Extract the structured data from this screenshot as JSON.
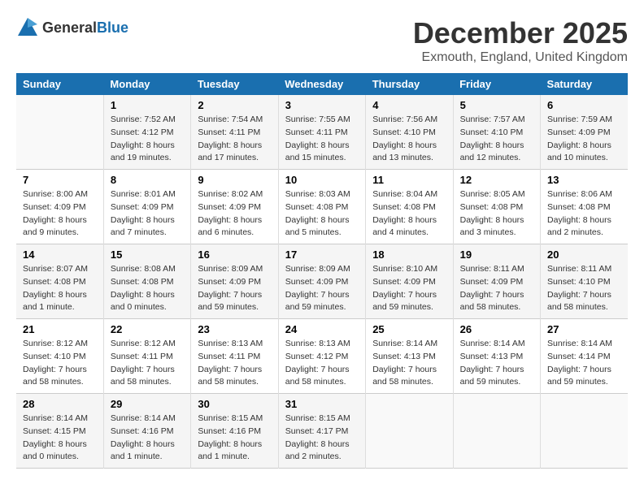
{
  "header": {
    "logo_general": "General",
    "logo_blue": "Blue",
    "month_title": "December 2025",
    "location": "Exmouth, England, United Kingdom"
  },
  "days_of_week": [
    "Sunday",
    "Monday",
    "Tuesday",
    "Wednesday",
    "Thursday",
    "Friday",
    "Saturday"
  ],
  "weeks": [
    [
      {
        "day": "",
        "info": ""
      },
      {
        "day": "1",
        "info": "Sunrise: 7:52 AM\nSunset: 4:12 PM\nDaylight: 8 hours\nand 19 minutes."
      },
      {
        "day": "2",
        "info": "Sunrise: 7:54 AM\nSunset: 4:11 PM\nDaylight: 8 hours\nand 17 minutes."
      },
      {
        "day": "3",
        "info": "Sunrise: 7:55 AM\nSunset: 4:11 PM\nDaylight: 8 hours\nand 15 minutes."
      },
      {
        "day": "4",
        "info": "Sunrise: 7:56 AM\nSunset: 4:10 PM\nDaylight: 8 hours\nand 13 minutes."
      },
      {
        "day": "5",
        "info": "Sunrise: 7:57 AM\nSunset: 4:10 PM\nDaylight: 8 hours\nand 12 minutes."
      },
      {
        "day": "6",
        "info": "Sunrise: 7:59 AM\nSunset: 4:09 PM\nDaylight: 8 hours\nand 10 minutes."
      }
    ],
    [
      {
        "day": "7",
        "info": "Sunrise: 8:00 AM\nSunset: 4:09 PM\nDaylight: 8 hours\nand 9 minutes."
      },
      {
        "day": "8",
        "info": "Sunrise: 8:01 AM\nSunset: 4:09 PM\nDaylight: 8 hours\nand 7 minutes."
      },
      {
        "day": "9",
        "info": "Sunrise: 8:02 AM\nSunset: 4:09 PM\nDaylight: 8 hours\nand 6 minutes."
      },
      {
        "day": "10",
        "info": "Sunrise: 8:03 AM\nSunset: 4:08 PM\nDaylight: 8 hours\nand 5 minutes."
      },
      {
        "day": "11",
        "info": "Sunrise: 8:04 AM\nSunset: 4:08 PM\nDaylight: 8 hours\nand 4 minutes."
      },
      {
        "day": "12",
        "info": "Sunrise: 8:05 AM\nSunset: 4:08 PM\nDaylight: 8 hours\nand 3 minutes."
      },
      {
        "day": "13",
        "info": "Sunrise: 8:06 AM\nSunset: 4:08 PM\nDaylight: 8 hours\nand 2 minutes."
      }
    ],
    [
      {
        "day": "14",
        "info": "Sunrise: 8:07 AM\nSunset: 4:08 PM\nDaylight: 8 hours\nand 1 minute."
      },
      {
        "day": "15",
        "info": "Sunrise: 8:08 AM\nSunset: 4:08 PM\nDaylight: 8 hours\nand 0 minutes."
      },
      {
        "day": "16",
        "info": "Sunrise: 8:09 AM\nSunset: 4:09 PM\nDaylight: 7 hours\nand 59 minutes."
      },
      {
        "day": "17",
        "info": "Sunrise: 8:09 AM\nSunset: 4:09 PM\nDaylight: 7 hours\nand 59 minutes."
      },
      {
        "day": "18",
        "info": "Sunrise: 8:10 AM\nSunset: 4:09 PM\nDaylight: 7 hours\nand 59 minutes."
      },
      {
        "day": "19",
        "info": "Sunrise: 8:11 AM\nSunset: 4:09 PM\nDaylight: 7 hours\nand 58 minutes."
      },
      {
        "day": "20",
        "info": "Sunrise: 8:11 AM\nSunset: 4:10 PM\nDaylight: 7 hours\nand 58 minutes."
      }
    ],
    [
      {
        "day": "21",
        "info": "Sunrise: 8:12 AM\nSunset: 4:10 PM\nDaylight: 7 hours\nand 58 minutes."
      },
      {
        "day": "22",
        "info": "Sunrise: 8:12 AM\nSunset: 4:11 PM\nDaylight: 7 hours\nand 58 minutes."
      },
      {
        "day": "23",
        "info": "Sunrise: 8:13 AM\nSunset: 4:11 PM\nDaylight: 7 hours\nand 58 minutes."
      },
      {
        "day": "24",
        "info": "Sunrise: 8:13 AM\nSunset: 4:12 PM\nDaylight: 7 hours\nand 58 minutes."
      },
      {
        "day": "25",
        "info": "Sunrise: 8:14 AM\nSunset: 4:13 PM\nDaylight: 7 hours\nand 58 minutes."
      },
      {
        "day": "26",
        "info": "Sunrise: 8:14 AM\nSunset: 4:13 PM\nDaylight: 7 hours\nand 59 minutes."
      },
      {
        "day": "27",
        "info": "Sunrise: 8:14 AM\nSunset: 4:14 PM\nDaylight: 7 hours\nand 59 minutes."
      }
    ],
    [
      {
        "day": "28",
        "info": "Sunrise: 8:14 AM\nSunset: 4:15 PM\nDaylight: 8 hours\nand 0 minutes."
      },
      {
        "day": "29",
        "info": "Sunrise: 8:14 AM\nSunset: 4:16 PM\nDaylight: 8 hours\nand 1 minute."
      },
      {
        "day": "30",
        "info": "Sunrise: 8:15 AM\nSunset: 4:16 PM\nDaylight: 8 hours\nand 1 minute."
      },
      {
        "day": "31",
        "info": "Sunrise: 8:15 AM\nSunset: 4:17 PM\nDaylight: 8 hours\nand 2 minutes."
      },
      {
        "day": "",
        "info": ""
      },
      {
        "day": "",
        "info": ""
      },
      {
        "day": "",
        "info": ""
      }
    ]
  ]
}
